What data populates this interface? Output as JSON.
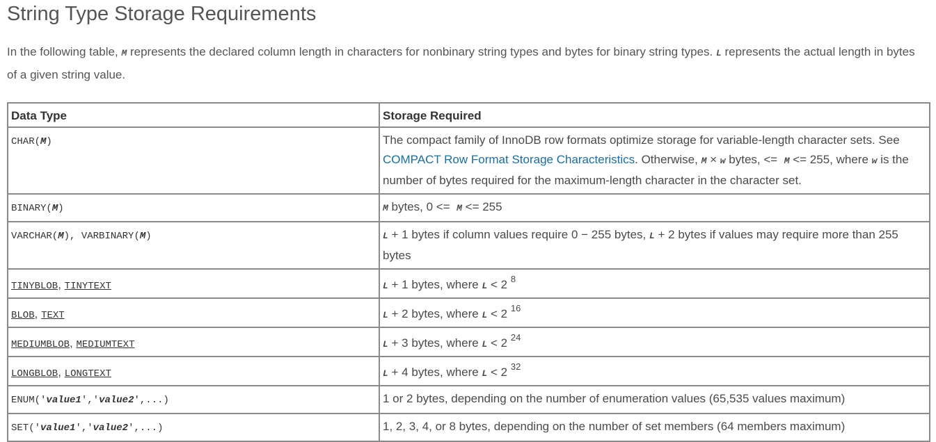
{
  "heading": "String Type Storage Requirements",
  "intro": {
    "part1": "In the following table, ",
    "var_m": "M",
    "part2": " represents the declared column length in characters for nonbinary string types and bytes for binary string types. ",
    "var_l": "L",
    "part3": " represents the actual length in bytes of a given string value."
  },
  "table": {
    "headers": {
      "data_type": "Data Type",
      "storage_required": "Storage Required"
    },
    "rows": {
      "char": {
        "type_prefix": "CHAR(",
        "type_var": "M",
        "type_suffix": ")",
        "storage_text1": "The compact family of InnoDB row formats optimize storage for variable-length character sets. See ",
        "storage_link": "COMPACT Row Format Storage Characteristics",
        "storage_text2": ". Otherwise, ",
        "storage_var_m": "M",
        "storage_times": " × ",
        "storage_var_w": "w",
        "storage_text3": " bytes, ",
        "storage_op1": "<=",
        "storage_var_m2": "M",
        "storage_text4": " <= 255, where ",
        "storage_var_w2": "w",
        "storage_text5": " is the number of bytes required for the maximum-length character in the character set."
      },
      "binary": {
        "type_prefix": "BINARY(",
        "type_var": "M",
        "type_suffix": ")",
        "storage_var": "M",
        "storage_text1": " bytes, 0 ",
        "storage_op": "<=",
        "storage_var2": "M",
        "storage_text2": " <= 255"
      },
      "varchar": {
        "type1_prefix": "VARCHAR(",
        "type1_var": "M",
        "type1_suffix": ")",
        "separator": ", ",
        "type2_prefix": "VARBINARY(",
        "type2_var": "M",
        "type2_suffix": ")",
        "storage_var1": "L",
        "storage_text1": " + 1 bytes if column values require 0 − 255 bytes, ",
        "storage_var2": "L",
        "storage_text2": " + 2 bytes if values may require more than 255 bytes"
      },
      "tinyblob": {
        "type1": "TINYBLOB",
        "separator": ", ",
        "type2": "TINYTEXT",
        "storage_var1": "L",
        "storage_text": " + 1 bytes, where ",
        "storage_var2": "L",
        "storage_base": " < 2",
        "storage_exp": "8"
      },
      "blob": {
        "type1": "BLOB",
        "separator": ", ",
        "type2": "TEXT",
        "storage_var1": "L",
        "storage_text": " + 2 bytes, where ",
        "storage_var2": "L",
        "storage_base": " < 2",
        "storage_exp": "16"
      },
      "mediumblob": {
        "type1": "MEDIUMBLOB",
        "separator": ", ",
        "type2": "MEDIUMTEXT",
        "storage_var1": "L",
        "storage_text": " + 3 bytes, where ",
        "storage_var2": "L",
        "storage_base": " < 2",
        "storage_exp": "24"
      },
      "longblob": {
        "type1": "LONGBLOB",
        "separator": ", ",
        "type2": "LONGTEXT",
        "storage_var1": "L",
        "storage_text": " + 4 bytes, where ",
        "storage_var2": "L",
        "storage_base": " < 2",
        "storage_exp": "32"
      },
      "enum": {
        "type_prefix": "ENUM('",
        "type_v1": "value1",
        "type_mid": "','",
        "type_v2": "value2",
        "type_suffix": "',...)",
        "storage": "1 or 2 bytes, depending on the number of enumeration values (65,535 values maximum)"
      },
      "set": {
        "type_prefix": "SET('",
        "type_v1": "value1",
        "type_mid": "','",
        "type_v2": "value2",
        "type_suffix": "',...)",
        "storage": "1, 2, 3, 4, or 8 bytes, depending on the number of set members (64 members maximum)"
      }
    }
  }
}
